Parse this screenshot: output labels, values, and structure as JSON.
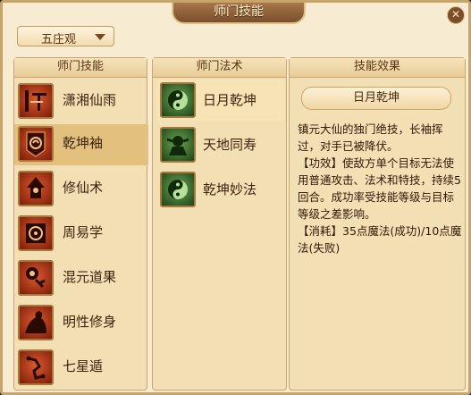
{
  "window": {
    "title": "师门技能",
    "close_label": "✕"
  },
  "sect_select": {
    "value": "五庄观"
  },
  "skills_panel": {
    "header": "师门技能",
    "items": [
      {
        "label": "潇湘仙雨",
        "icon": "rain-icon",
        "selected": false
      },
      {
        "label": "乾坤袖",
        "icon": "sleeve-icon",
        "selected": true
      },
      {
        "label": "修仙术",
        "icon": "cultivation-icon",
        "selected": false
      },
      {
        "label": "周易学",
        "icon": "yijing-icon",
        "selected": false
      },
      {
        "label": "混元道果",
        "icon": "dao-fruit-icon",
        "selected": false
      },
      {
        "label": "明性修身",
        "icon": "meditation-icon",
        "selected": false
      },
      {
        "label": "七星遁",
        "icon": "seven-stars-icon",
        "selected": false
      }
    ]
  },
  "spells_panel": {
    "header": "师门法术",
    "items": [
      {
        "label": "日月乾坤",
        "icon": "sun-moon-icon",
        "selected": true
      },
      {
        "label": "天地同寿",
        "icon": "heaven-earth-icon",
        "selected": false
      },
      {
        "label": "乾坤妙法",
        "icon": "yinyang-icon",
        "selected": false
      }
    ]
  },
  "effect_panel": {
    "header": "技能效果",
    "spell_name": "日月乾坤",
    "line1": "镇元大仙的独门绝技，长袖挥过，对手已被降伏。",
    "line2": "【功效】使敌方单个目标无法使用普通攻击、法术和特技，持续5回合。成功率受技能等级与目标等级之差影响。",
    "line3": "【消耗】35点魔法(成功)/10点魔法(失败)"
  }
}
